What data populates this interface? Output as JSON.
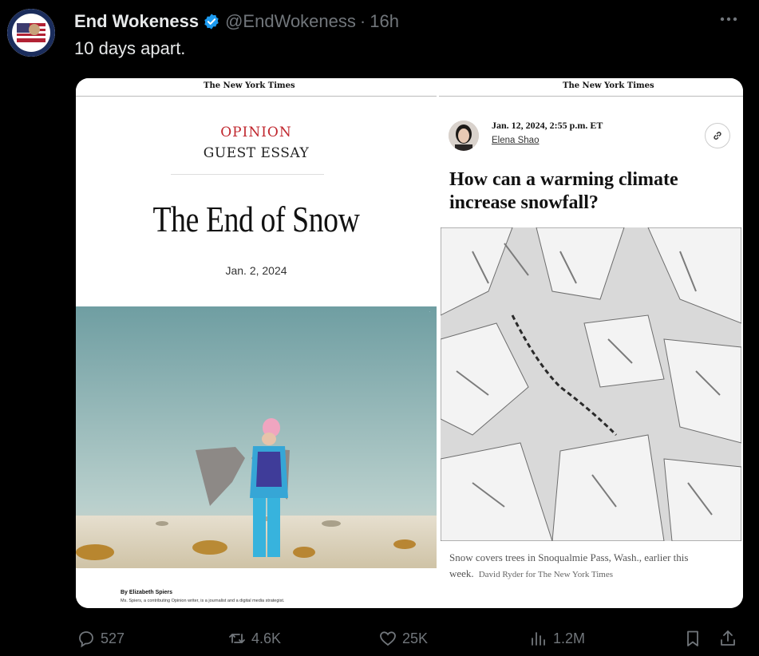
{
  "tweet": {
    "display_name": "End Wokeness",
    "handle": "@EndWokeness",
    "separator": "·",
    "time": "16h",
    "text": "10 days apart.",
    "more_icon": "more-horizontal-icon"
  },
  "left_article": {
    "masthead": "The New York Times",
    "section": "OPINION",
    "kicker": "GUEST ESSAY",
    "headline": "The End of Snow",
    "date": "Jan. 2, 2024",
    "byline": "By Elizabeth Spiers",
    "bio": "Ms. Spiers, a contributing Opinion writer, is a journalist and a digital media strategist.",
    "accent_color": "#c0262d"
  },
  "right_article": {
    "masthead": "The New York Times",
    "date": "Jan. 12, 2024, 2:55 p.m. ET",
    "author": "Elena Shao",
    "headline": "How can a warming climate increase snowfall?",
    "caption": "Snow covers trees in Snoqualmie Pass, Wash., earlier this week.",
    "photo_credit": "David Ryder for The New York Times"
  },
  "actions": {
    "replies": "527",
    "reposts": "4.6K",
    "likes": "25K",
    "views": "1.2M"
  }
}
